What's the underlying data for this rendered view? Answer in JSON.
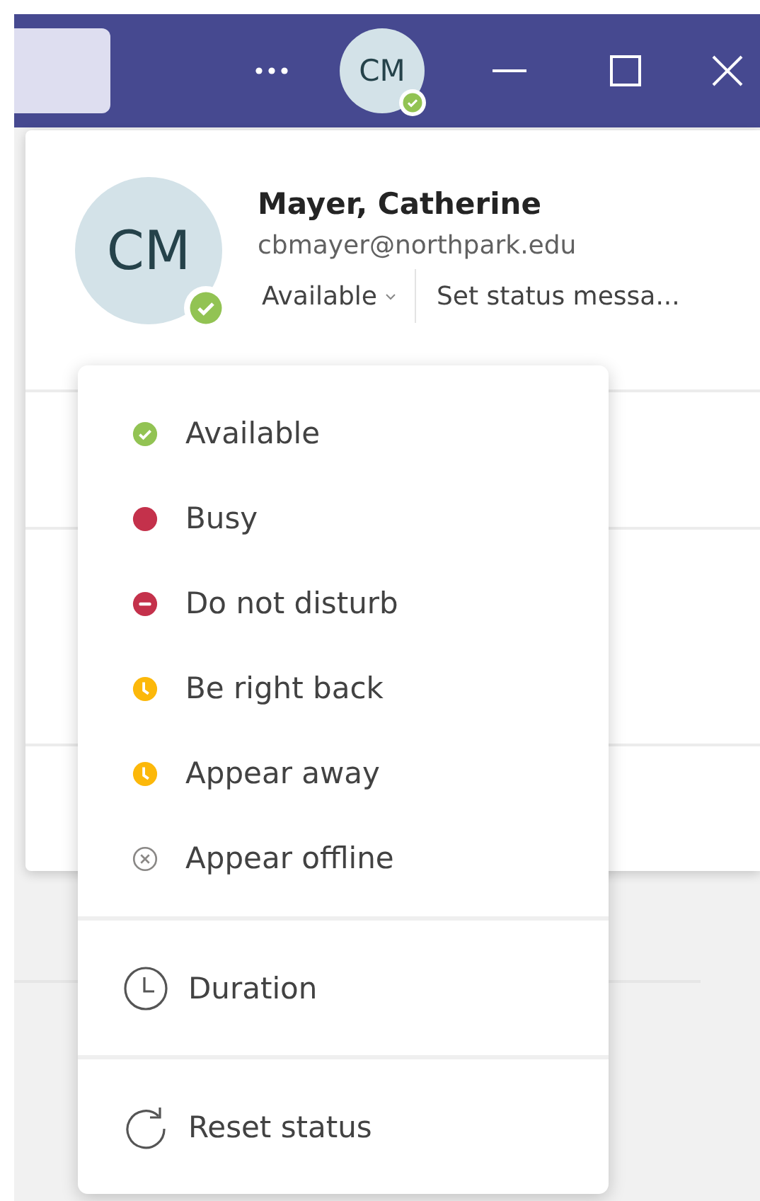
{
  "title_bar": {
    "avatar_initials": "CM",
    "presence_badge": {
      "kind": "available"
    }
  },
  "profile": {
    "initials": "CM",
    "presence_badge": {
      "kind": "available"
    },
    "name": "Mayer, Catherine",
    "email": "cbmayer@northpark.edu",
    "status": "Available",
    "status_message": "Set status messa..."
  },
  "status_menu": {
    "statuses": [
      {
        "kind": "available",
        "label": "Available"
      },
      {
        "kind": "busy",
        "label": "Busy"
      },
      {
        "kind": "dnd",
        "label": "Do not disturb"
      },
      {
        "kind": "brb",
        "label": "Be right back"
      },
      {
        "kind": "away",
        "label": "Appear away"
      },
      {
        "kind": "offline",
        "label": "Appear offline"
      }
    ],
    "actions": [
      {
        "kind": "duration",
        "label": "Duration"
      },
      {
        "kind": "reset",
        "label": "Reset status"
      }
    ]
  }
}
